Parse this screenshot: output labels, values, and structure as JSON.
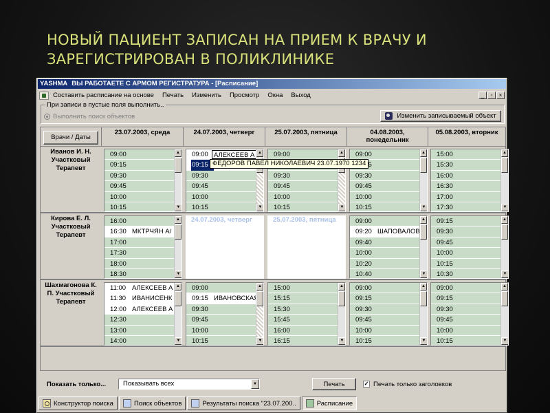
{
  "slide": {
    "title_line1": "НОВЫЙ ПАЦИЕНТ ЗАПИСАН НА ПРИЕМ К ВРАЧУ И",
    "title_line2": "ЗАРЕГИСТРИРОВАН В ПОЛИКЛИНИКЕ"
  },
  "window": {
    "brand": "YASHMA",
    "title": "ВЫ РАБОТАЕТЕ С АРМОМ РЕГИСТРАТУРА - [Расписание]",
    "controls": [
      "_",
      "▫",
      "×"
    ]
  },
  "menu": [
    "Составить расписание на основе",
    "Печать",
    "Изменить",
    "Просмотр",
    "Окна",
    "Выход"
  ],
  "options": {
    "group_label": "При записи в пустые поля выполнить..",
    "radio_label": "Выполнить поиск объектов",
    "object_button": "Изменить записываемый объект"
  },
  "schedule": {
    "corner_label": "Врачи / Даты",
    "days": [
      {
        "line1": "23.07.2003, среда",
        "line2": ""
      },
      {
        "line1": "24.07.2003, четверг",
        "line2": ""
      },
      {
        "line1": "25.07.2003, пятница",
        "line2": ""
      },
      {
        "line1": "04.08.2003,",
        "line2": "понедельник"
      },
      {
        "line1": "05.08.2003, вторник",
        "line2": ""
      }
    ],
    "doctors": [
      {
        "name": [
          "Иванов И. Н.",
          "Участковый",
          "Терапевт"
        ],
        "cells": [
          {
            "slots": [
              {
                "t": "09:00"
              },
              {
                "t": "09:15"
              },
              {
                "t": "09:30"
              },
              {
                "t": "09:45"
              },
              {
                "t": "10:00"
              },
              {
                "t": "10:15"
              }
            ]
          },
          {
            "slots": [
              {
                "t": "09:00",
                "p": "АЛЕКСЕЕВ А"
              },
              {
                "t": "09:15",
                "p": "",
                "sel": true
              },
              {
                "t": "09:30"
              },
              {
                "t": "09:45"
              },
              {
                "t": "10:00"
              },
              {
                "t": "10:15"
              }
            ]
          },
          {
            "slots": [
              {
                "t": "09:00"
              },
              {
                "t": "09:15"
              },
              {
                "t": "09:30"
              },
              {
                "t": "09:45"
              },
              {
                "t": "10:00"
              },
              {
                "t": "10:15"
              }
            ]
          },
          {
            "slots": [
              {
                "t": "09:00"
              },
              {
                "t": "09:15"
              },
              {
                "t": "09:30"
              },
              {
                "t": "09:45"
              },
              {
                "t": "10:00"
              },
              {
                "t": "10:15"
              }
            ]
          },
          {
            "slots": [
              {
                "t": "15:00"
              },
              {
                "t": "15:30"
              },
              {
                "t": "16:00"
              },
              {
                "t": "16:30"
              },
              {
                "t": "17:00"
              },
              {
                "t": "17:30"
              }
            ]
          }
        ]
      },
      {
        "name": [
          "Кирова Е. Л.",
          "Участковый",
          "Терапевт"
        ],
        "cells": [
          {
            "slots": [
              {
                "t": "16:00"
              },
              {
                "t": "16:30",
                "p": "МКТРЧЯН А/"
              },
              {
                "t": "17:00"
              },
              {
                "t": "17:30"
              },
              {
                "t": "18:00"
              },
              {
                "t": "18:30"
              }
            ]
          },
          {
            "empty": "24.07.2003, четверг"
          },
          {
            "empty": "25.07.2003, пятница"
          },
          {
            "slots": [
              {
                "t": "09:00"
              },
              {
                "t": "09:20",
                "p": "ШАПОВАЛОВ"
              },
              {
                "t": "09:40"
              },
              {
                "t": "10:00"
              },
              {
                "t": "10:20"
              },
              {
                "t": "10:40"
              }
            ]
          },
          {
            "slots": [
              {
                "t": "09:15"
              },
              {
                "t": "09:30"
              },
              {
                "t": "09:45"
              },
              {
                "t": "10:00"
              },
              {
                "t": "10:15"
              },
              {
                "t": "10:30"
              }
            ]
          }
        ]
      },
      {
        "name": [
          "Шахмагонова К.",
          "П. Участковый",
          "Терапевт"
        ],
        "cells": [
          {
            "slots": [
              {
                "t": "11:00",
                "p": "АЛЕКСЕЕВ А"
              },
              {
                "t": "11:30",
                "p": "ИВАНИСЕНК"
              },
              {
                "t": "12:00",
                "p": "АЛЕКСЕЕВ А"
              },
              {
                "t": "12:30"
              },
              {
                "t": "13:00"
              },
              {
                "t": "14:00"
              }
            ]
          },
          {
            "slots": [
              {
                "t": "09:00"
              },
              {
                "t": "09:15",
                "p": "ИВАНОВСКАЯ"
              },
              {
                "t": "09:30"
              },
              {
                "t": "09:45"
              },
              {
                "t": "10:00"
              },
              {
                "t": "10:15"
              }
            ]
          },
          {
            "slots": [
              {
                "t": "15:00"
              },
              {
                "t": "15:15"
              },
              {
                "t": "15:30"
              },
              {
                "t": "15:45"
              },
              {
                "t": "16:00"
              },
              {
                "t": "16:15"
              }
            ]
          },
          {
            "slots": [
              {
                "t": "09:00"
              },
              {
                "t": "09:15"
              },
              {
                "t": "09:30"
              },
              {
                "t": "09:45"
              },
              {
                "t": "10:00"
              },
              {
                "t": "10:15"
              }
            ]
          },
          {
            "slots": [
              {
                "t": "09:00"
              },
              {
                "t": "09:15"
              },
              {
                "t": "09:30"
              },
              {
                "t": "09:45"
              },
              {
                "t": "10:00"
              },
              {
                "t": "10:15"
              }
            ]
          }
        ]
      }
    ],
    "tooltip": "ФЕДОРОВ ПАВЕЛ НИКОЛАЕВИЧ 23.07.1970 1234"
  },
  "bottom": {
    "show_label": "Показать только...",
    "combo_value": "Показывать всех",
    "print_button": "Печать",
    "checkbox_label": "Печать только заголовков",
    "checkbox_checked": true
  },
  "tabs": [
    {
      "label": "Конструктор поиска",
      "icon": "s"
    },
    {
      "label": "Поиск объектов",
      "icon": "r"
    },
    {
      "label": "Результаты поиска \"23.07.200..",
      "icon": "r"
    },
    {
      "label": "Расписание",
      "icon": "g",
      "active": true
    }
  ]
}
